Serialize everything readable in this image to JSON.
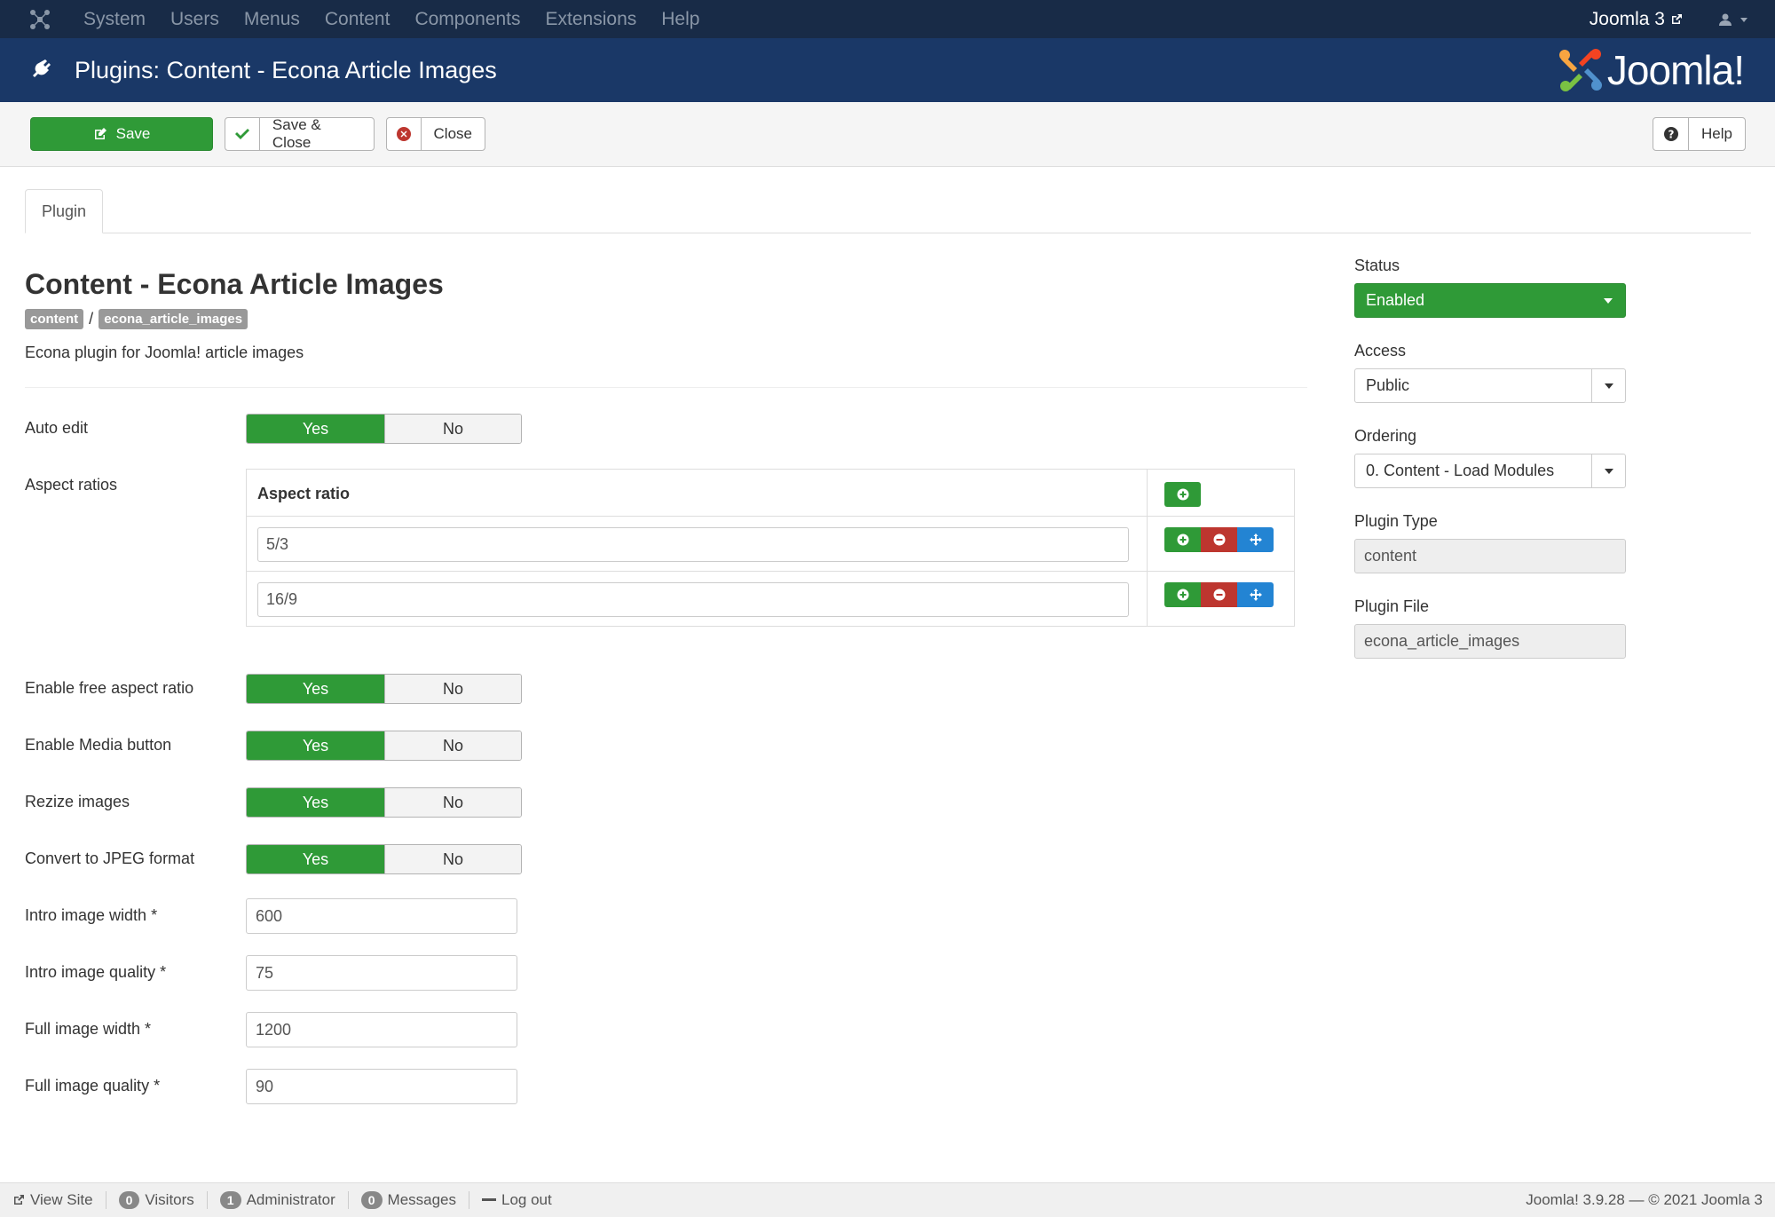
{
  "navbar": {
    "menu": [
      "System",
      "Users",
      "Menus",
      "Content",
      "Components",
      "Extensions",
      "Help"
    ],
    "site_label": "Joomla 3"
  },
  "header": {
    "title": "Plugins: Content - Econa Article Images",
    "logo_text": "Joomla!"
  },
  "toolbar": {
    "save": "Save",
    "save_close": "Save & Close",
    "close": "Close",
    "help": "Help"
  },
  "tabs": [
    "Plugin"
  ],
  "plugin": {
    "title": "Content - Econa Article Images",
    "group_badge": "content",
    "separator": "/",
    "element_badge": "econa_article_images",
    "description": "Econa plugin for Joomla! article images"
  },
  "fields": {
    "auto_edit": {
      "label": "Auto edit",
      "yes": "Yes",
      "no": "No",
      "value": "Yes"
    },
    "aspect_ratios": {
      "label": "Aspect ratios",
      "column_header": "Aspect ratio",
      "rows": [
        "5/3",
        "16/9"
      ]
    },
    "free_aspect": {
      "label": "Enable free aspect ratio",
      "yes": "Yes",
      "no": "No",
      "value": "Yes"
    },
    "media_button": {
      "label": "Enable Media button",
      "yes": "Yes",
      "no": "No",
      "value": "Yes"
    },
    "resize": {
      "label": "Rezize images",
      "yes": "Yes",
      "no": "No",
      "value": "Yes"
    },
    "jpeg": {
      "label": "Convert to JPEG format",
      "yes": "Yes",
      "no": "No",
      "value": "Yes"
    },
    "intro_width": {
      "label": "Intro image width *",
      "value": "600"
    },
    "intro_quality": {
      "label": "Intro image quality *",
      "value": "75"
    },
    "full_width": {
      "label": "Full image width *",
      "value": "1200"
    },
    "full_quality": {
      "label": "Full image quality *",
      "value": "90"
    }
  },
  "sidebar": {
    "status": {
      "label": "Status",
      "value": "Enabled"
    },
    "access": {
      "label": "Access",
      "value": "Public"
    },
    "ordering": {
      "label": "Ordering",
      "value": "0. Content - Load Modules"
    },
    "plugin_type": {
      "label": "Plugin Type",
      "value": "content"
    },
    "plugin_file": {
      "label": "Plugin File",
      "value": "econa_article_images"
    }
  },
  "statusbar": {
    "view_site": "View Site",
    "visitors_count": "0",
    "visitors": "Visitors",
    "admin_count": "1",
    "admin": "Administrator",
    "messages_count": "0",
    "messages": "Messages",
    "logout": "Log out",
    "version": "Joomla! 3.9.28  —  © 2021 Joomla 3"
  },
  "colors": {
    "navbar": "#182b47",
    "header": "#1a3867",
    "success": "#2f9a37",
    "danger": "#bd362f",
    "primary": "#2384d3"
  }
}
